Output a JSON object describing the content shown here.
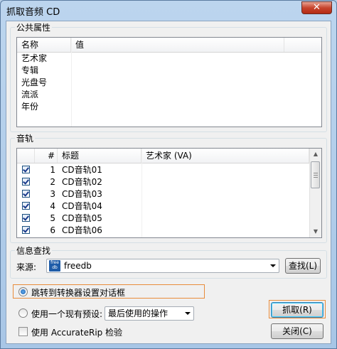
{
  "window": {
    "title": "抓取音频 CD",
    "close_glyph": "✕"
  },
  "common": {
    "group_label": "公共属性",
    "headers": [
      "名称",
      "值"
    ],
    "rows": [
      {
        "name": "艺术家",
        "value": ""
      },
      {
        "name": "专辑",
        "value": ""
      },
      {
        "name": "光盘号",
        "value": ""
      },
      {
        "name": "流派",
        "value": ""
      },
      {
        "name": "年份",
        "value": ""
      }
    ]
  },
  "tracks": {
    "group_label": "音轨",
    "headers": [
      "#",
      "标题",
      "艺术家 (VA)"
    ],
    "rows": [
      {
        "checked": true,
        "num": "1",
        "title": "CD音轨01",
        "artist": ""
      },
      {
        "checked": true,
        "num": "2",
        "title": "CD音轨02",
        "artist": ""
      },
      {
        "checked": true,
        "num": "3",
        "title": "CD音轨03",
        "artist": ""
      },
      {
        "checked": true,
        "num": "4",
        "title": "CD音轨04",
        "artist": ""
      },
      {
        "checked": true,
        "num": "5",
        "title": "CD音轨05",
        "artist": ""
      },
      {
        "checked": true,
        "num": "6",
        "title": "CD音轨06",
        "artist": ""
      }
    ]
  },
  "lookup": {
    "group_label": "信息查找",
    "source_label": "来源:",
    "source_value": "freedb",
    "source_icon": "freedb-icon",
    "icon_text_top": "free",
    "icon_text_bottom": "db",
    "search_button": "查找(L)"
  },
  "options": {
    "radio_converter": "跳转到转换器设置对话框",
    "radio_preset": "使用一个现有预设:",
    "preset_value": "最后使用的操作",
    "accuraterip": "使用 AccurateRip 检验",
    "selected": "converter",
    "accuraterip_checked": false
  },
  "buttons": {
    "rip": "抓取(R)",
    "close": "关闭(C)"
  },
  "colors": {
    "accent_highlight": "#e88c3b",
    "close_red": "#c7452e"
  }
}
